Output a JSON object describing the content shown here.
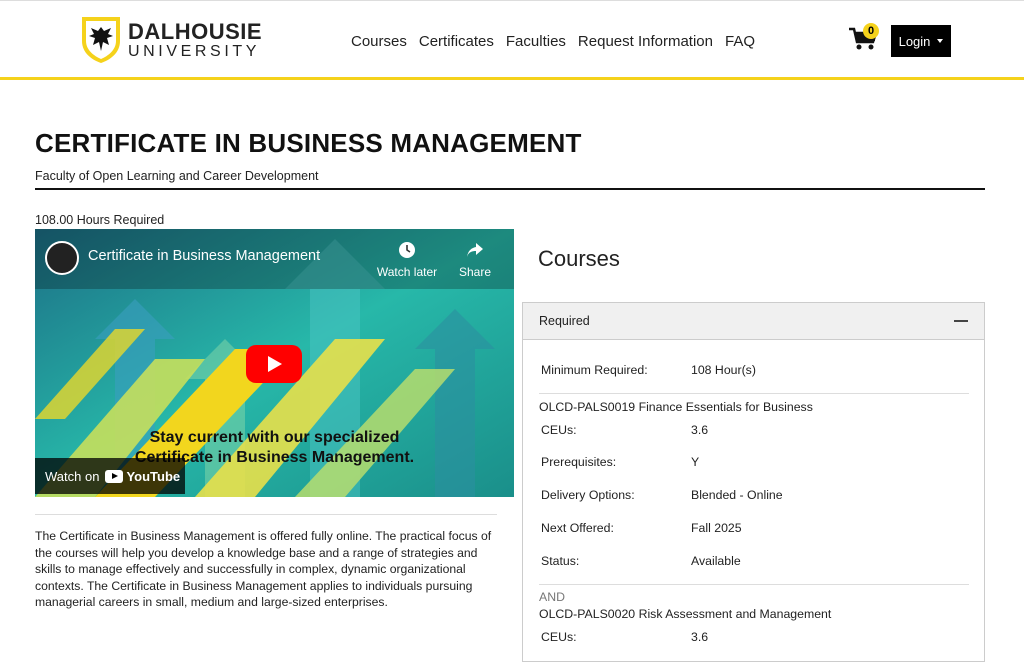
{
  "header": {
    "logo_main": "DALHOUSIE",
    "logo_sub": "UNIVERSITY",
    "nav": [
      "Courses",
      "Certificates",
      "Faculties",
      "Request Information",
      "FAQ"
    ],
    "cart_count": "0",
    "login_label": "Login",
    "accent_color": "#f5d21b"
  },
  "program": {
    "title": "CERTIFICATE IN BUSINESS MANAGEMENT",
    "faculty": "Faculty of Open Learning and Career Development",
    "hours": "108.00 Hours Required",
    "description": "The Certificate in Business Management is offered fully online. The practical focus of the courses will help you develop a knowledge base and a range of strategies and skills to manage effectively and successfully in complex, dynamic organizational contexts. The Certificate in Business Management applies to individuals pursuing managerial careers in small, medium and large-sized enterprises."
  },
  "video": {
    "title": "Certificate in Business Management",
    "watch_later": "Watch later",
    "share": "Share",
    "caption_line1": "Stay current with our specialized",
    "caption_line2": "Certificate in Business Management.",
    "watch_on": "Watch on",
    "youtube": "YouTube"
  },
  "courses": {
    "heading": "Courses",
    "panel_label": "Required",
    "min_label": "Minimum Required:",
    "min_value": "108 Hour(s)",
    "and_label": "AND",
    "items": [
      {
        "title": "OLCD-PALS0019 Finance Essentials for Business",
        "fields": [
          {
            "label": "CEUs:",
            "value": "3.6"
          },
          {
            "label": "Prerequisites:",
            "value": "Y"
          },
          {
            "label": "Delivery Options:",
            "value": "Blended - Online"
          },
          {
            "label": "Next Offered:",
            "value": "Fall 2025"
          },
          {
            "label": "Status:",
            "value": "Available"
          }
        ]
      },
      {
        "title": "OLCD-PALS0020 Risk Assessment and Management",
        "fields": [
          {
            "label": "CEUs:",
            "value": "3.6"
          }
        ]
      }
    ]
  }
}
